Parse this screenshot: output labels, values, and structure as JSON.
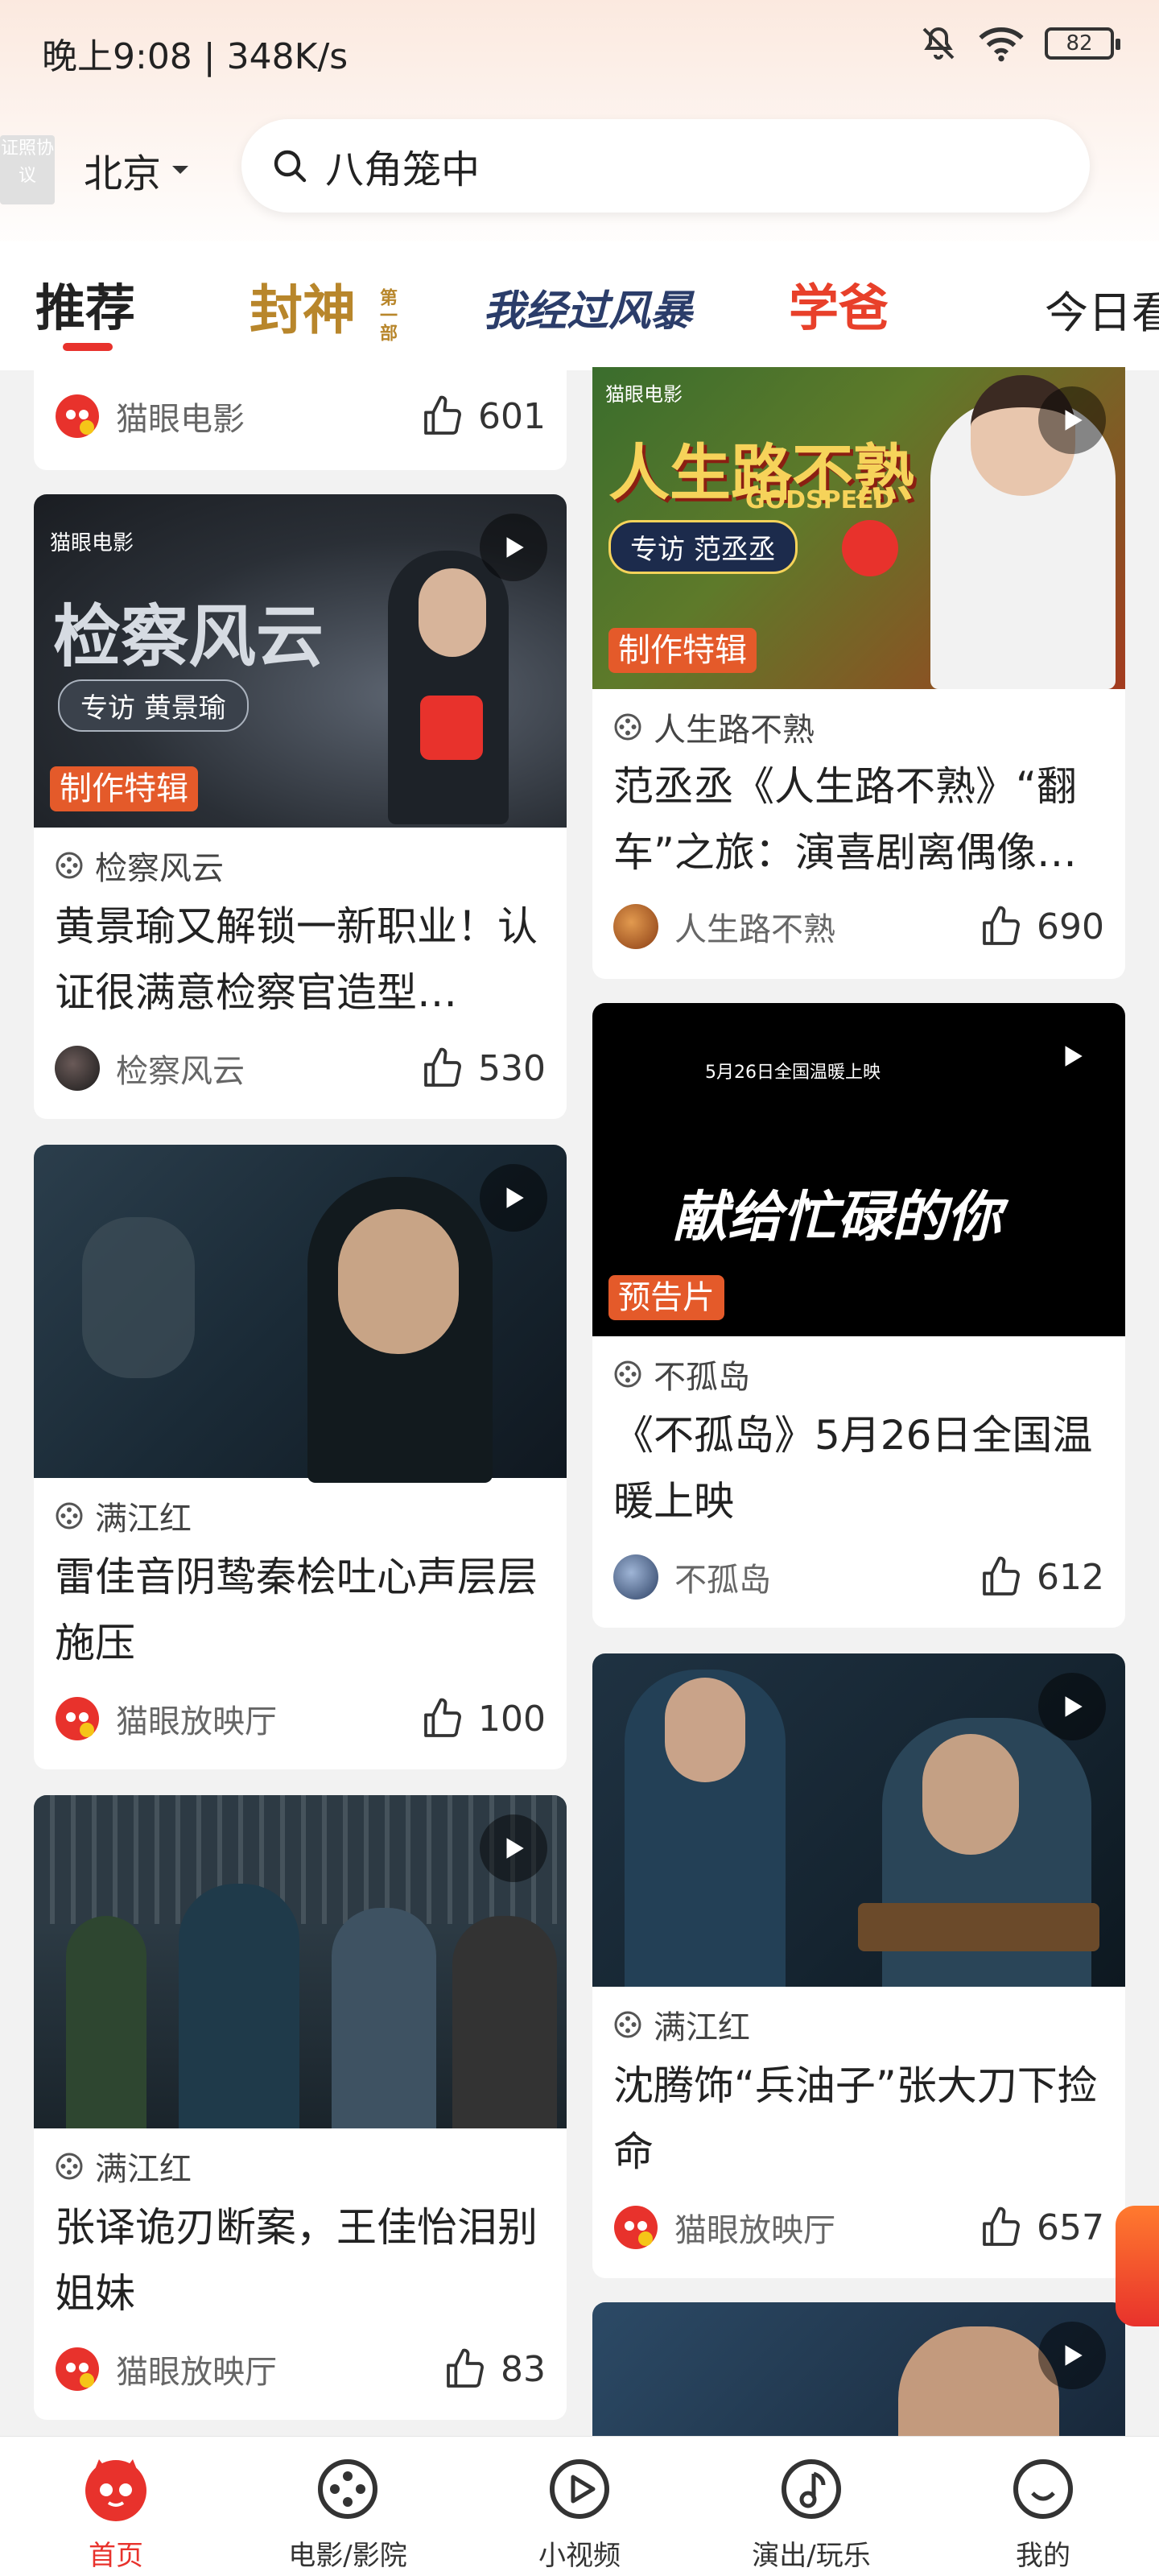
{
  "status_bar": {
    "time": "晚上9:08 | 348K/s",
    "battery": "82"
  },
  "header": {
    "cert_badge": "证照协议",
    "city": "北京",
    "search_text": "八角笼中"
  },
  "tabs": [
    {
      "label": "推荐",
      "active": true
    },
    {
      "label": "封神",
      "subtitle": "第一部"
    },
    {
      "label": "我经过风暴"
    },
    {
      "label": "学爸"
    },
    {
      "label": "今日看"
    }
  ],
  "cards": [
    {
      "id": "top-left-partial",
      "author": "猫眼电影",
      "likes": "601"
    },
    {
      "id": "procurator",
      "thumb_text": "检察风云",
      "thumb_subtitle": "专访  黄景瑜",
      "brand": "猫眼电影",
      "tag": "制作特辑",
      "movie": "检察风云",
      "title": "黄景瑜又解锁一新职业！认证很满意检察官造型…",
      "author": "检察风云",
      "likes": "530"
    },
    {
      "id": "manjianghong-1",
      "movie": "满江红",
      "title": "雷佳音阴鸷秦桧吐心声层层施压",
      "author": "猫眼放映厅",
      "likes": "100"
    },
    {
      "id": "manjianghong-2",
      "movie": "满江红",
      "title": "张译诡刃断案，王佳怡泪别姐妹",
      "author": "猫眼放映厅",
      "likes": "83"
    },
    {
      "id": "godspeed",
      "thumb_text": "人生路不熟",
      "thumb_subtitle": "GODSPEED",
      "thumb_badge": "专访 范丞丞",
      "brand": "猫眼电影",
      "tag": "制作特辑",
      "movie": "人生路不熟",
      "title": "范丞丞《人生路不熟》“翻车”之旅：演喜剧离偶像…",
      "author": "人生路不熟",
      "likes": "690"
    },
    {
      "id": "lonely-island",
      "thumb_caption": "5月26日全国温暖上映",
      "thumb_text": "献给忙碌的你",
      "tag": "预告片",
      "movie": "不孤岛",
      "title": "《不孤岛》5月26日全国温暖上映",
      "author": "不孤岛",
      "likes": "612"
    },
    {
      "id": "manjianghong-3",
      "movie": "满江红",
      "title": "沈腾饰“兵油子”张大刀下捡命",
      "author": "猫眼放映厅",
      "likes": "657"
    }
  ],
  "bottom_nav": [
    {
      "label": "首页",
      "icon": "cat-logo-icon",
      "active": true
    },
    {
      "label": "电影/影院",
      "icon": "film-reel-icon"
    },
    {
      "label": "小视频",
      "icon": "play-circle-icon"
    },
    {
      "label": "演出/玩乐",
      "icon": "music-note-icon"
    },
    {
      "label": "我的",
      "icon": "profile-icon"
    }
  ],
  "colors": {
    "accent": "#e8322c",
    "tag": "#e45a2a"
  }
}
